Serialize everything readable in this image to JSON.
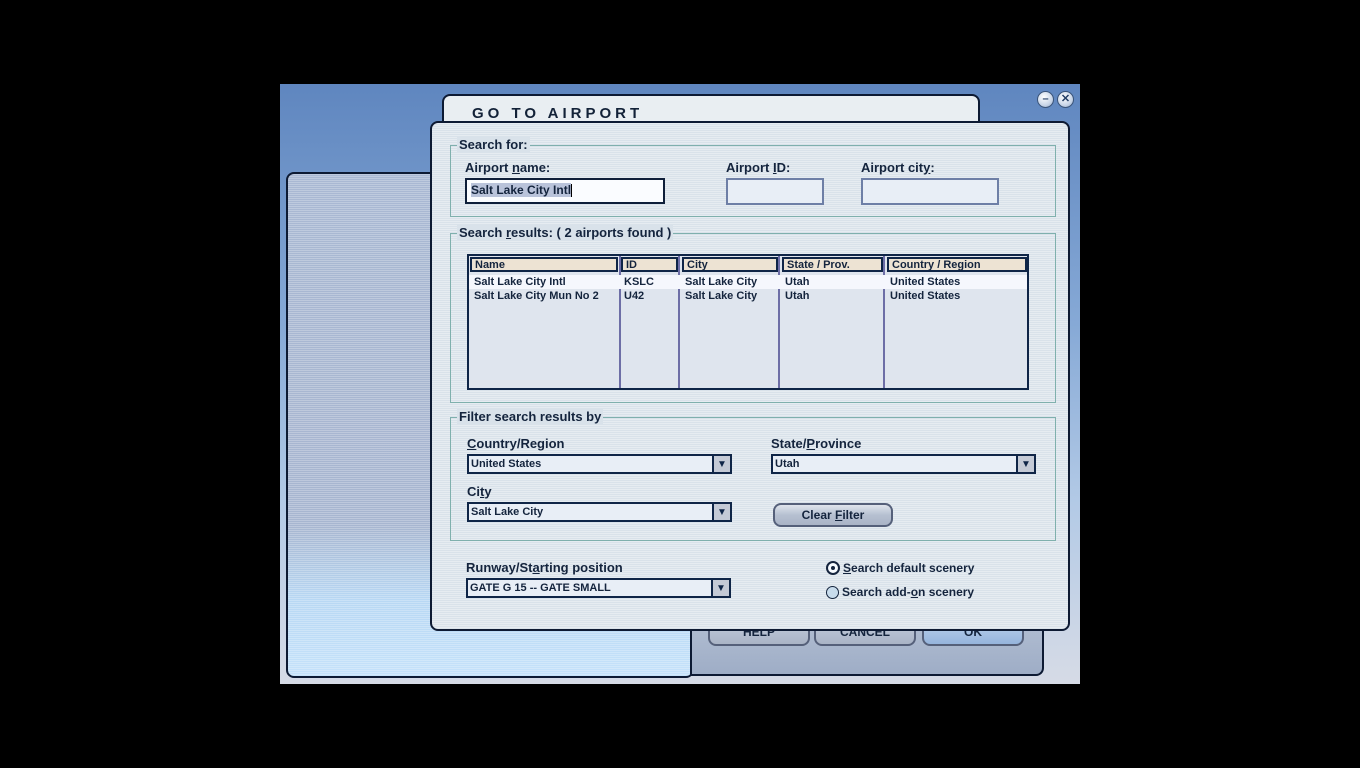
{
  "window": {
    "title": "GO TO AIRPORT",
    "controls": [
      {
        "name": "minimize",
        "icon": "minimize-icon",
        "glyph": "–"
      },
      {
        "name": "close",
        "icon": "close-icon",
        "glyph": "✕"
      }
    ]
  },
  "search_for": {
    "legend": "Search for:",
    "airport_name": {
      "label_pre": "Airport ",
      "label_key": "n",
      "label_post": "ame:",
      "value": "Salt Lake City Intl"
    },
    "airport_id": {
      "label_pre": "Airport ",
      "label_key": "I",
      "label_post": "D:",
      "value": ""
    },
    "airport_city": {
      "label_pre": "Airport cit",
      "label_key": "y",
      "label_post": ":",
      "value": ""
    }
  },
  "search_results": {
    "legend_pre": "Search ",
    "legend_key": "r",
    "legend_post": "esults: ( 2 airports found )",
    "columns": [
      "Name",
      "ID",
      "City",
      "State / Prov.",
      "Country / Region"
    ],
    "rows": [
      {
        "name": "Salt Lake City Intl",
        "id": "KSLC",
        "city": "Salt Lake City",
        "state": "Utah",
        "country": "United States",
        "selected": true
      },
      {
        "name": "Salt Lake City Mun No 2",
        "id": "U42",
        "city": "Salt Lake City",
        "state": "Utah",
        "country": "United States",
        "selected": false
      }
    ]
  },
  "filter": {
    "legend": "Filter search results by",
    "country": {
      "label_pre": "",
      "label_key": "C",
      "label_post": "ountry/Region",
      "value": "United States"
    },
    "state": {
      "label_pre": "State/",
      "label_key": "P",
      "label_post": "rovince",
      "value": "Utah"
    },
    "city": {
      "label_pre": "Ci",
      "label_key": "t",
      "label_post": "y",
      "value": "Salt Lake City"
    },
    "clear_pre": "Clear ",
    "clear_key": "F",
    "clear_post": "ilter"
  },
  "runway": {
    "label_pre": "Runway/St",
    "label_key": "a",
    "label_post": "rting position",
    "value": "GATE G 15 -- GATE SMALL"
  },
  "scenery": {
    "default": {
      "label_pre": "",
      "label_key": "S",
      "label_post": "earch default scenery",
      "checked": true
    },
    "addon": {
      "label_pre": "Search add-",
      "label_key": "o",
      "label_post": "n scenery",
      "checked": false
    }
  },
  "buttons": {
    "help": "HELP",
    "cancel": "CANCEL",
    "ok": "OK"
  }
}
